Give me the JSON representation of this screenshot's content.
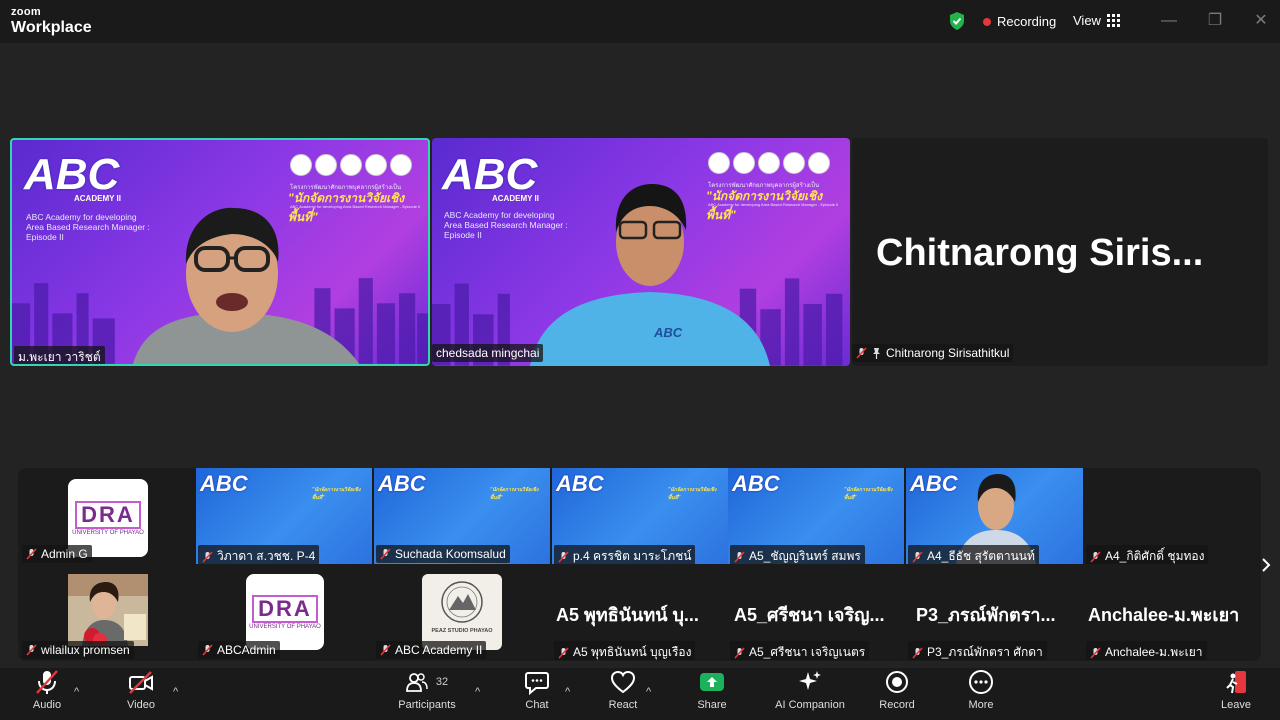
{
  "app": {
    "logo_line1": "zoom",
    "logo_line2": "Workplace",
    "recording": "Recording",
    "view": "View"
  },
  "colors": {
    "active_speaker_border": "#33d6b2",
    "recording_dot": "#e5373d",
    "share_green": "#1bb15d",
    "leave_red": "#e5373d"
  },
  "background": {
    "logo": "ABC",
    "academy": "ACADEMY II",
    "subtitle_lines": [
      "ABC Academy for developing",
      "Area Based Research Manager :",
      "Episode II"
    ],
    "thai_title_small": "โครงการพัฒนาศักยภาพบุคลากรผู้สร้างเป็น",
    "thai_title": "\"นักจัดการงานวิจัยเชิงพื้นที่\"",
    "thai_title_en": "ABC Academy for developing Area Based Research Manager - Episode II"
  },
  "main_tiles": [
    {
      "name": "ม.พะเยา วาริชต์"
    },
    {
      "name": "chedsada mingchai"
    },
    {
      "display_name": "Chitnarong  Siris...",
      "name": "Chitnarong Sirisathitkul"
    }
  ],
  "gallery": {
    "row1": [
      {
        "name": "Admin G",
        "type": "logo"
      },
      {
        "name": "วิภาดา ส.วชช. P-4",
        "type": "bg"
      },
      {
        "name": "Suchada Koomsalud",
        "type": "bg"
      },
      {
        "name": "p.4 ครรชิต มาระโภชน์",
        "type": "bg"
      },
      {
        "name": "A5_ชัญญรินทร์ สมพร",
        "type": "bg"
      },
      {
        "name": "A4_ธีธัช สุรัตตานนท์",
        "type": "video"
      },
      {
        "name": "A4_กิติศักดิ์ ชุมทอง",
        "type": "blank"
      }
    ],
    "row2": [
      {
        "name": "wilailux promsen",
        "type": "photo"
      },
      {
        "name": "ABCAdmin",
        "type": "logo"
      },
      {
        "name": "ABC Academy II",
        "type": "stamp"
      },
      {
        "display_name": "A5 พุทธินันทน์ บุ...",
        "name": "A5 พุทธินันทน์ บุญเรือง",
        "type": "text"
      },
      {
        "display_name": "A5_ศรีชนา เจริญ...",
        "name": "A5_ศรีชนา เจริญเนตร",
        "type": "text"
      },
      {
        "display_name": "P3_ภรณ์พักตรา...",
        "name": "P3_ภรณ์พักตรา ศักดา",
        "type": "text"
      },
      {
        "display_name": "Anchalee-ม.พะเยา",
        "name": "Anchalee-ม.พะเยา",
        "type": "text"
      }
    ],
    "dra_word": "DRA",
    "dra_sub": "UNIVERSITY OF PHAYAO",
    "stamp_text": "PEAZ STUDIO PHAYAO"
  },
  "toolbar": {
    "audio": "Audio",
    "video": "Video",
    "participants": "Participants",
    "participants_count": "32",
    "chat": "Chat",
    "react": "React",
    "share": "Share",
    "ai_companion": "AI Companion",
    "record": "Record",
    "more": "More",
    "leave": "Leave"
  }
}
